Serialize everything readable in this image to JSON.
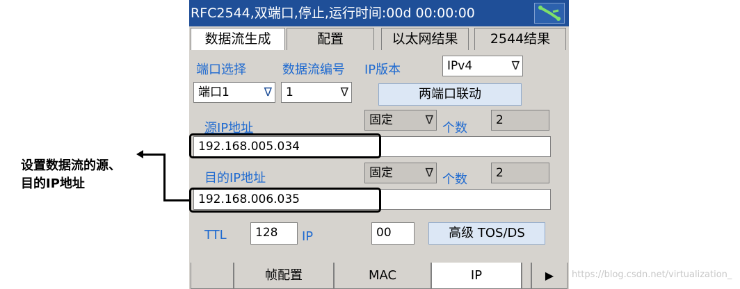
{
  "titlebar": {
    "text": "RFC2544,双端口,停止,运行时间:00d 00:00:00",
    "status_icon": "network-status-icon"
  },
  "tabs": [
    {
      "label": "数据流生成",
      "active": true
    },
    {
      "label": "配置",
      "active": false
    },
    {
      "label": "以太网结果",
      "active": false
    },
    {
      "label": "2544结果",
      "active": false
    }
  ],
  "form": {
    "port_select_label": "端口选择",
    "stream_no_label": "数据流编号",
    "ip_version_label": "IP版本",
    "ip_version_value": "IPv4",
    "port_value": "端口1",
    "stream_no_value": "1",
    "link_button": "两端口联动",
    "src_ip_label": "源IP地址",
    "src_mode": "固定",
    "src_count_label": "个数",
    "src_count": "2",
    "src_ip_value": "192.168.005.034",
    "dst_ip_label": "目的IP地址",
    "dst_mode": "固定",
    "dst_count_label": "个数",
    "dst_count": "2",
    "dst_ip_value": "192.168.006.035",
    "ttl_label": "TTL",
    "ttl_value": "128",
    "ip_label": "IP",
    "ip_value": "00",
    "advanced_button": "高级 TOS/DS",
    "arrow_glyph": "∇"
  },
  "bottom_tabs": [
    {
      "label": "",
      "active": false
    },
    {
      "label": "帧配置",
      "active": false
    },
    {
      "label": "MAC",
      "active": false
    },
    {
      "label": "IP",
      "active": true
    },
    {
      "label": "",
      "active": false
    },
    {
      "label": "▶",
      "active": false
    }
  ],
  "annotation": {
    "line1": "设置数据流的源、",
    "line2": "目的IP地址"
  },
  "watermark": "https://blog.csdn.net/virtualization_"
}
